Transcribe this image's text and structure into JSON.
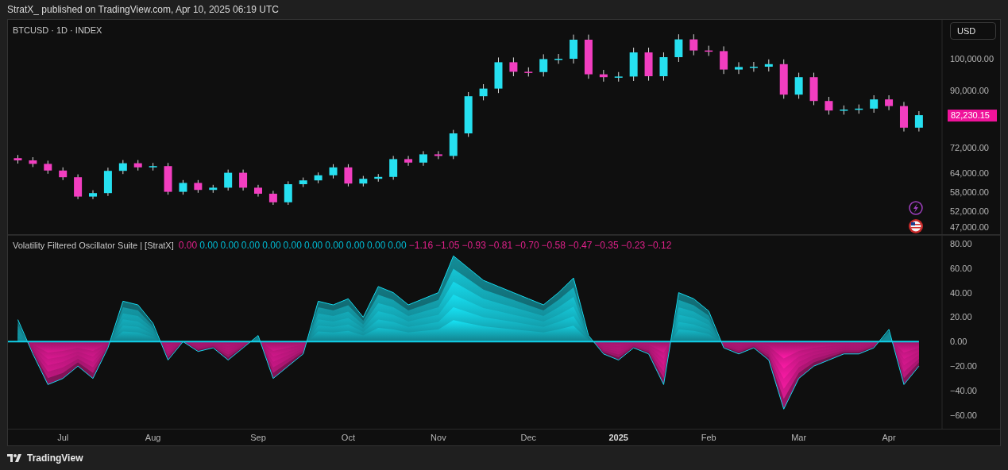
{
  "header": {
    "text": "StratX_ published on TradingView.com, Apr 10, 2025 06:19 UTC"
  },
  "price_pane": {
    "symbol": "BTCUSD · 1D · INDEX",
    "currency_button": "USD",
    "last_price": "82,230.15",
    "chart_data": {
      "type": "candlestick",
      "ylim": [
        44500,
        112250
      ],
      "categories": [
        null,
        null,
        null,
        null,
        null,
        null,
        null,
        null,
        null,
        null,
        null,
        null,
        null,
        null,
        null,
        null,
        null,
        null,
        null,
        null,
        null,
        null,
        null,
        null,
        null,
        null,
        null,
        null,
        null,
        null,
        null,
        null,
        null,
        null,
        null,
        null,
        null,
        null,
        null,
        null,
        null,
        null,
        null,
        null,
        null,
        null,
        null,
        null,
        null,
        null,
        null,
        null,
        null,
        null,
        null,
        null,
        null,
        null,
        null,
        null,
        null
      ],
      "yticks": [
        {
          "value": 100000,
          "label": "100,000.00"
        },
        {
          "value": 90000,
          "label": "90,000.00"
        },
        {
          "value": 72000,
          "label": "72,000.00"
        },
        {
          "value": 64000,
          "label": "64,000.00"
        },
        {
          "value": 58000,
          "label": "58,000.00"
        },
        {
          "value": 52000,
          "label": "52,000.00"
        },
        {
          "value": 47000,
          "label": "47,000.00"
        }
      ],
      "ohlc": [
        [
          68700,
          69700,
          67000,
          68000
        ],
        [
          68000,
          69000,
          65900,
          66900
        ],
        [
          66900,
          67900,
          63800,
          64800
        ],
        [
          64800,
          65800,
          61800,
          62700
        ],
        [
          62700,
          63600,
          55800,
          56600
        ],
        [
          56600,
          58600,
          55800,
          57700
        ],
        [
          57700,
          65700,
          56800,
          64700
        ],
        [
          64700,
          68100,
          63700,
          67100
        ],
        [
          67100,
          68100,
          64800,
          65800
        ],
        [
          65800,
          67200,
          64800,
          66200
        ],
        [
          66200,
          67200,
          57200,
          58100
        ],
        [
          58100,
          61800,
          57200,
          60900
        ],
        [
          60900,
          61800,
          57800,
          58700
        ],
        [
          58700,
          60300,
          57800,
          59400
        ],
        [
          59400,
          65100,
          58500,
          64100
        ],
        [
          64100,
          65100,
          58500,
          59400
        ],
        [
          59400,
          60300,
          56600,
          57500
        ],
        [
          57500,
          58400,
          54000,
          54800
        ],
        [
          54800,
          61400,
          54000,
          60500
        ],
        [
          60500,
          62600,
          59600,
          61700
        ],
        [
          61700,
          64200,
          60800,
          63300
        ],
        [
          63300,
          66800,
          62300,
          65800
        ],
        [
          65800,
          66800,
          59800,
          60700
        ],
        [
          60700,
          63100,
          59800,
          62200
        ],
        [
          62200,
          63700,
          61300,
          62800
        ],
        [
          62800,
          69400,
          61900,
          68400
        ],
        [
          68400,
          69400,
          66300,
          67300
        ],
        [
          67300,
          70900,
          66300,
          69900
        ],
        [
          69900,
          70900,
          68400,
          69400
        ],
        [
          69400,
          77600,
          68400,
          76500
        ],
        [
          76500,
          89500,
          75400,
          88200
        ],
        [
          88200,
          92000,
          86900,
          90600
        ],
        [
          90600,
          100400,
          89200,
          98900
        ],
        [
          98900,
          100400,
          94500,
          95900
        ],
        [
          95900,
          97300,
          94400,
          95800
        ],
        [
          95800,
          101400,
          94400,
          99900
        ],
        [
          99900,
          101500,
          98400,
          100000
        ],
        [
          100000,
          107600,
          98500,
          106000
        ],
        [
          106000,
          107600,
          93700,
          95100
        ],
        [
          95100,
          96500,
          92800,
          94200
        ],
        [
          94200,
          95800,
          92800,
          94400
        ],
        [
          94400,
          103500,
          93000,
          102000
        ],
        [
          102000,
          103500,
          93100,
          94500
        ],
        [
          94500,
          102000,
          93100,
          100500
        ],
        [
          100500,
          107700,
          99000,
          106100
        ],
        [
          106100,
          107700,
          101100,
          102600
        ],
        [
          102600,
          104100,
          100900,
          102400
        ],
        [
          102400,
          103900,
          95200,
          96600
        ],
        [
          96600,
          98900,
          95200,
          97400
        ],
        [
          97400,
          99000,
          95900,
          97500
        ],
        [
          97500,
          99800,
          96000,
          98300
        ],
        [
          98300,
          99800,
          87400,
          88700
        ],
        [
          88700,
          95600,
          87400,
          94200
        ],
        [
          94200,
          95600,
          85400,
          86700
        ],
        [
          86700,
          88000,
          82400,
          83700
        ],
        [
          83700,
          85300,
          82400,
          84000
        ],
        [
          84000,
          85600,
          82700,
          84300
        ],
        [
          84300,
          88500,
          83000,
          87200
        ],
        [
          87200,
          88500,
          83800,
          85100
        ],
        [
          85100,
          86400,
          77100,
          78300
        ],
        [
          78300,
          83500,
          77100,
          82230
        ]
      ]
    }
  },
  "oscillator_pane": {
    "title": "Volatility Filtered Oscillator Suite | [StratX]",
    "legend": [
      {
        "value": "0.00",
        "color": "#e0218a"
      },
      {
        "value": "0.00",
        "color": "#00bcd4"
      },
      {
        "value": "0.00",
        "color": "#00bcd4"
      },
      {
        "value": "0.00",
        "color": "#00bcd4"
      },
      {
        "value": "0.00",
        "color": "#00bcd4"
      },
      {
        "value": "0.00",
        "color": "#00bcd4"
      },
      {
        "value": "0.00",
        "color": "#00bcd4"
      },
      {
        "value": "0.00",
        "color": "#00bcd4"
      },
      {
        "value": "0.00",
        "color": "#00bcd4"
      },
      {
        "value": "0.00",
        "color": "#00bcd4"
      },
      {
        "value": "0.00",
        "color": "#00bcd4"
      },
      {
        "value": "−1.16",
        "color": "#e0218a"
      },
      {
        "value": "−1.05",
        "color": "#e0218a"
      },
      {
        "value": "−0.93",
        "color": "#e0218a"
      },
      {
        "value": "−0.81",
        "color": "#e0218a"
      },
      {
        "value": "−0.70",
        "color": "#e0218a"
      },
      {
        "value": "−0.58",
        "color": "#e0218a"
      },
      {
        "value": "−0.47",
        "color": "#e0218a"
      },
      {
        "value": "−0.35",
        "color": "#e0218a"
      },
      {
        "value": "−0.23",
        "color": "#e0218a"
      },
      {
        "value": "−0.12",
        "color": "#e0218a"
      }
    ],
    "chart_data": {
      "type": "area",
      "ylim": [
        -71,
        87
      ],
      "categories": [
        null,
        null,
        null,
        "Jul",
        null,
        null,
        null,
        null,
        null,
        "Aug",
        null,
        null,
        null,
        null,
        null,
        null,
        "Sep",
        null,
        null,
        null,
        null,
        null,
        "Oct",
        null,
        null,
        null,
        null,
        null,
        "Nov",
        null,
        null,
        null,
        null,
        null,
        "Dec",
        null,
        null,
        null,
        null,
        null,
        "2025",
        null,
        null,
        null,
        null,
        null,
        "Feb",
        null,
        null,
        null,
        null,
        null,
        "Mar",
        null,
        null,
        null,
        null,
        null,
        "Apr",
        null,
        null
      ],
      "yticks": [
        {
          "value": 80,
          "label": "80.00"
        },
        {
          "value": 60,
          "label": "60.00"
        },
        {
          "value": 40,
          "label": "40.00"
        },
        {
          "value": 20,
          "label": "20.00"
        },
        {
          "value": 0,
          "label": "0.00"
        },
        {
          "value": -20,
          "label": "−20.00"
        },
        {
          "value": -40,
          "label": "−40.00"
        },
        {
          "value": -60,
          "label": "−60.00"
        }
      ],
      "ref_lines": [
        {
          "axis": "y",
          "value": 0
        }
      ],
      "series": [
        {
          "values": [
            18,
            -10,
            -35,
            -30,
            -20,
            -30,
            -5,
            33,
            30,
            15,
            -15,
            0,
            -8,
            -5,
            -15,
            -5,
            5,
            -30,
            -20,
            -10,
            33,
            30,
            35,
            20,
            45,
            40,
            30,
            35,
            40,
            70,
            60,
            50,
            45,
            40,
            35,
            30,
            40,
            52,
            5,
            -10,
            -15,
            -5,
            -10,
            -35,
            40,
            35,
            25,
            -5,
            -10,
            -5,
            -15,
            -55,
            -30,
            -20,
            -15,
            -10,
            -10,
            -5,
            10,
            -35,
            -20
          ]
        }
      ]
    }
  },
  "footer": {
    "brand": "TradingView"
  }
}
